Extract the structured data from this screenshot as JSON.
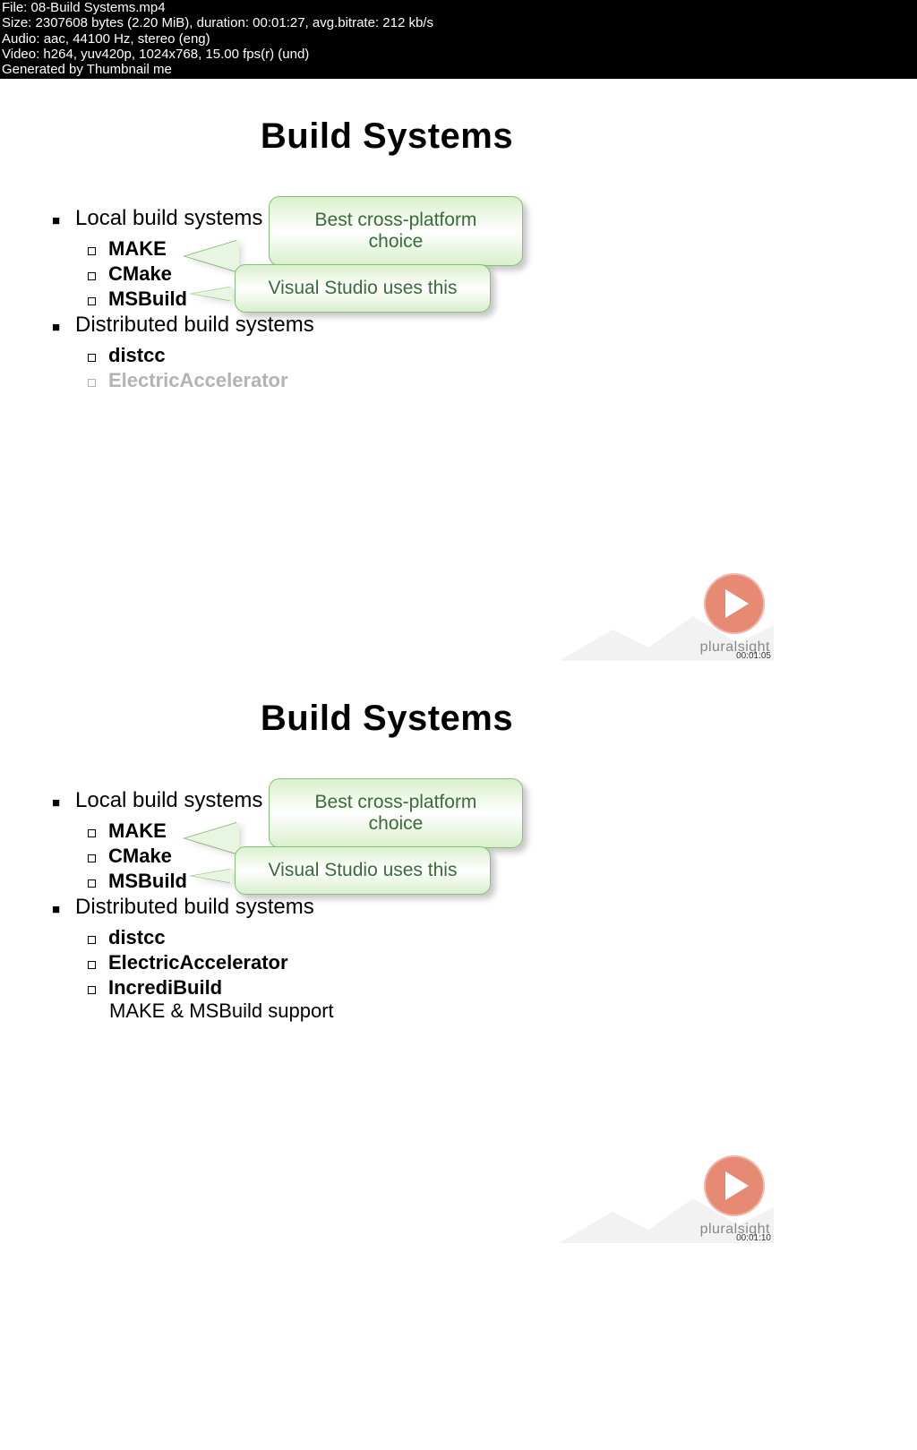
{
  "header": {
    "file": "File: 08-Build Systems.mp4",
    "size": "Size: 2307608 bytes (2.20 MiB), duration: 00:01:27, avg.bitrate: 212 kb/s",
    "audio": "Audio: aac, 44100 Hz, stereo (eng)",
    "video": "Video: h264, yuv420p, 1024x768, 15.00 fps(r) (und)",
    "gen": "Generated by Thumbnail me"
  },
  "slide": {
    "title": "Build Systems",
    "local_heading": "Local build systems",
    "local_items": {
      "make": "MAKE",
      "cmake": "CMake",
      "msbuild": "MSBuild"
    },
    "dist_heading": "Distributed build systems",
    "dist_items": {
      "distcc": "distcc",
      "electric": "ElectricAccelerator",
      "incred": "IncrediBuild",
      "incred_sub": "MAKE & MSBuild support"
    },
    "callout_cmake": "Best cross-platform choice",
    "callout_msbuild": "Visual Studio uses this"
  },
  "watermark": {
    "brand": "pluralsight"
  },
  "timestamps": {
    "t1": "00:01:05",
    "t2": "00:01:10"
  }
}
